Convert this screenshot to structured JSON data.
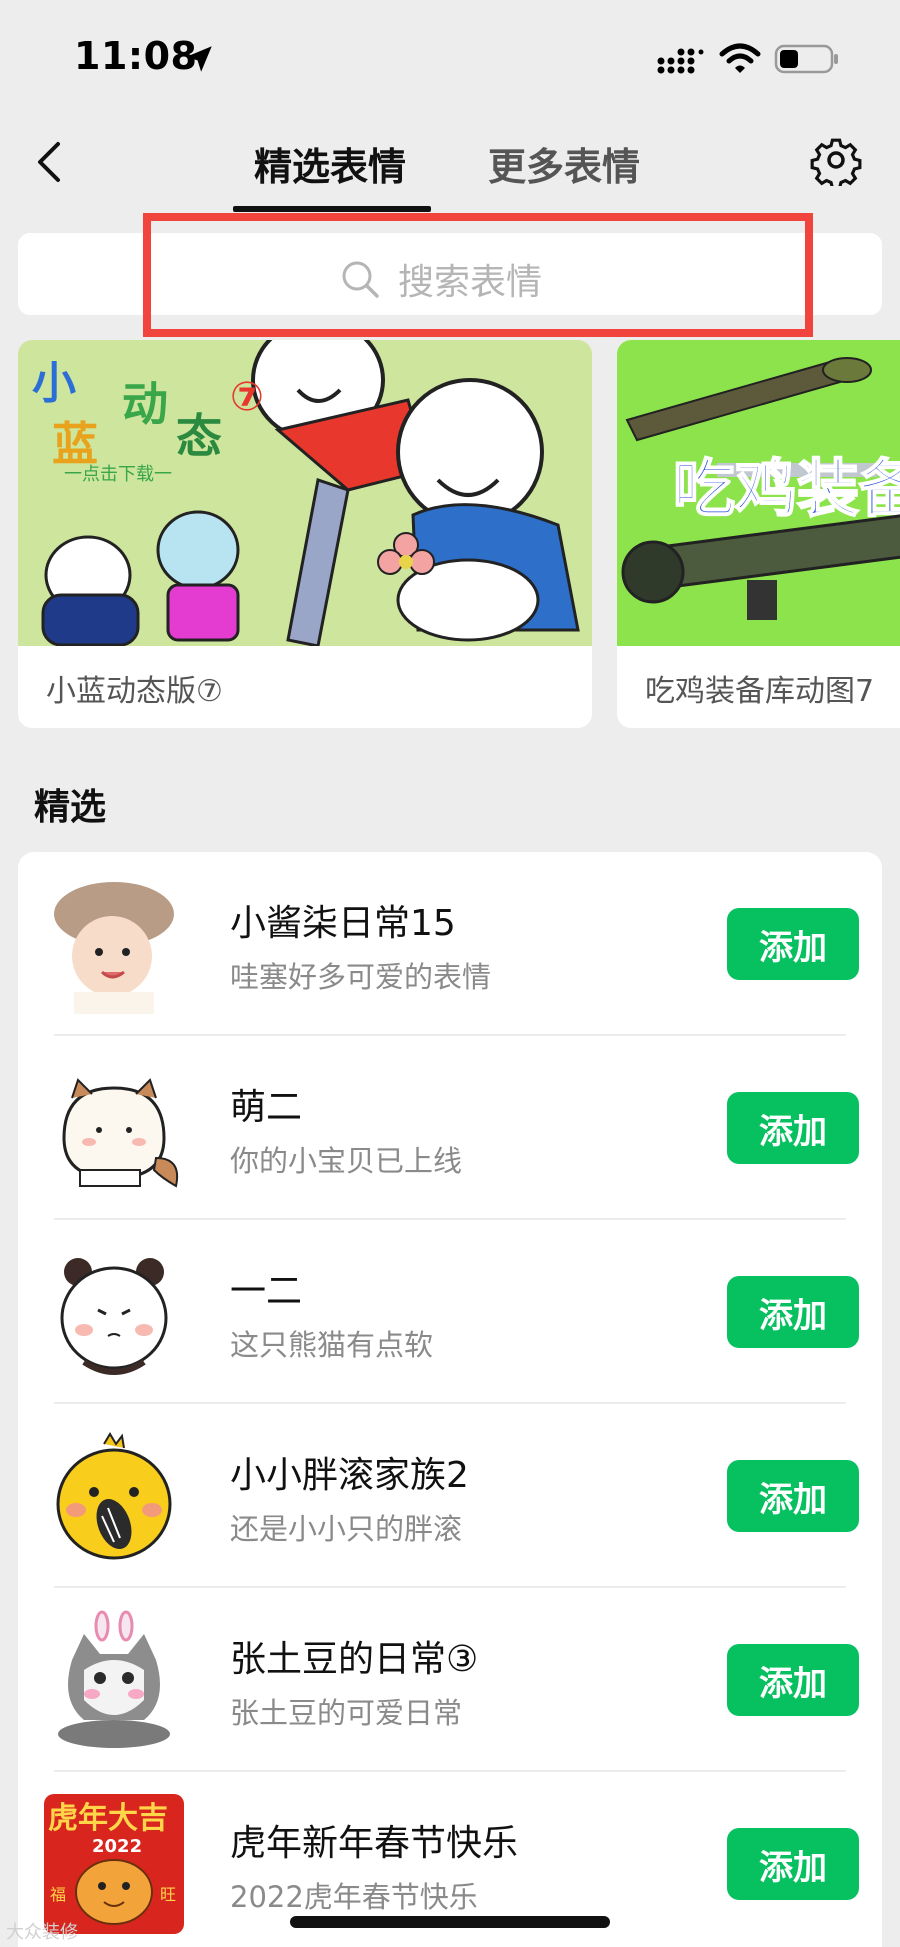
{
  "status_bar": {
    "time": "11:08",
    "icons": [
      "location-arrow-icon",
      "signal-icon",
      "wifi-icon",
      "battery-icon"
    ]
  },
  "nav": {
    "back_icon": "chevron-left-icon",
    "tabs": [
      {
        "label": "精选表情",
        "active": true
      },
      {
        "label": "更多表情",
        "active": false
      }
    ],
    "settings_icon": "gear-icon"
  },
  "search": {
    "placeholder": "搜索表情",
    "icon": "search-icon",
    "highlight_color": "#f0443c"
  },
  "banners": [
    {
      "caption": "小蓝动态版⑦",
      "art_text": [
        "小",
        "蓝",
        "动",
        "态",
        "⑦"
      ],
      "art_subtext": "一点击下载一"
    },
    {
      "caption": "吃鸡装备库动图7",
      "art_text": "吃鸡装备"
    }
  ],
  "section_title": "精选",
  "list": [
    {
      "title": "小酱柒日常15",
      "desc": "哇塞好多可爱的表情",
      "button": "添加"
    },
    {
      "title": "萌二",
      "desc": "你的小宝贝已上线",
      "button": "添加"
    },
    {
      "title": "一二",
      "desc": "这只熊猫有点软",
      "button": "添加"
    },
    {
      "title": "小小胖滚家族2",
      "desc": "还是小小只的胖滚",
      "button": "添加"
    },
    {
      "title": "张土豆的日常③",
      "desc": "张土豆的可爱日常",
      "button": "添加"
    },
    {
      "title": "虎年新年春节快乐",
      "desc": "2022虎年春节快乐",
      "button": "添加",
      "thumb_text": [
        "虎年大吉",
        "2022",
        "福",
        "旺"
      ]
    }
  ],
  "colors": {
    "accent_green": "#07c160",
    "background": "#ededed",
    "card": "#ffffff"
  },
  "watermark": "大众装修"
}
